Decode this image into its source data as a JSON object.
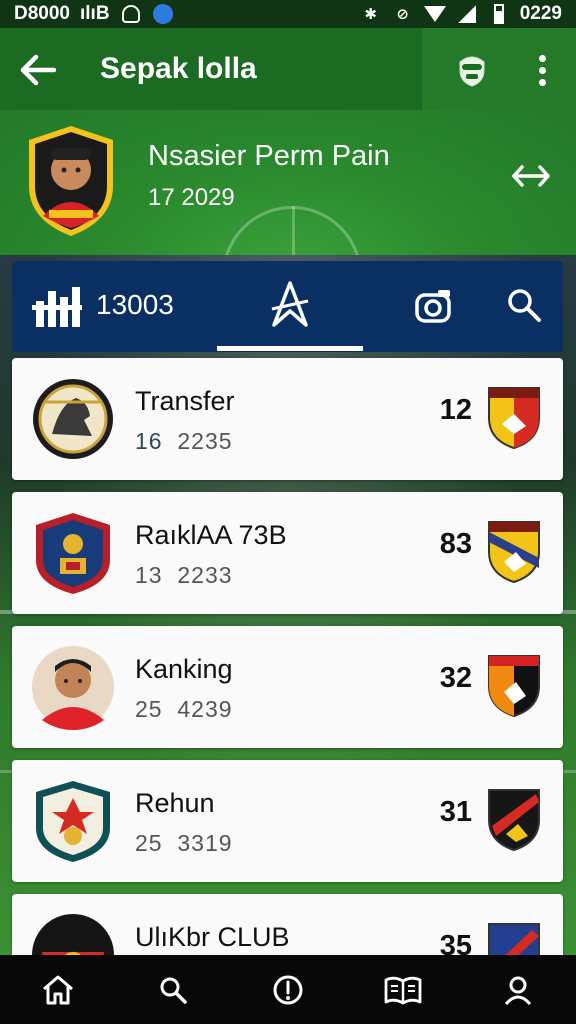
{
  "status_bar": {
    "time_left": "D8000",
    "app_glyphs": "ılıB",
    "time_right": "0229"
  },
  "app_bar": {
    "title": "Sepak lolla"
  },
  "profile": {
    "name": "Nsasier Perm Pain",
    "date": "17  2029"
  },
  "toolbar": {
    "count": "13003"
  },
  "cards": [
    {
      "title": "Transfer",
      "sub_a": "16",
      "sub_b": "2235",
      "score": "12",
      "logo": "eagle-crest-icon",
      "badge": "red-yellow-shield-icon"
    },
    {
      "title": "RaıklAA 73B",
      "sub_a": "13",
      "sub_b": "2233",
      "score": "83",
      "logo": "red-blue-crest-icon",
      "badge": "yellow-shield-icon"
    },
    {
      "title": "Kanking",
      "sub_a": "25",
      "sub_b": "4239",
      "score": "32",
      "logo": "player-avatar-icon",
      "badge": "black-orange-shield-icon"
    },
    {
      "title": "Rehun",
      "sub_a": "25",
      "sub_b": "3319",
      "score": "31",
      "logo": "green-crest-icon",
      "badge": "black-red-shield-icon"
    },
    {
      "title": "UlıKbr CLUB",
      "sub_a": "",
      "sub_b": "",
      "score": "35",
      "logo": "red-club-crest-icon",
      "badge": "blue-red-shield-icon"
    }
  ],
  "colors": {
    "app_bar": "#1c6b22",
    "toolbar": "#0a2f63",
    "bottom_nav": "#080808"
  }
}
